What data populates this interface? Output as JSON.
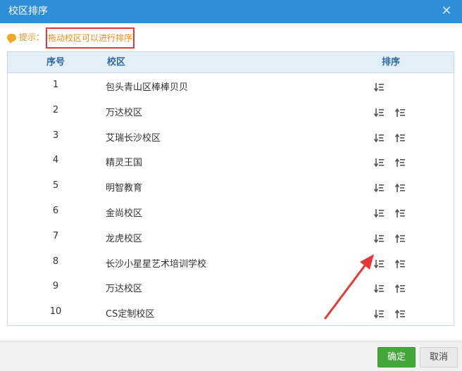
{
  "dialog": {
    "title": "校区排序",
    "close_icon": "close-icon"
  },
  "tip": {
    "label": "提示：",
    "message": "拖动校区可以进行排序"
  },
  "table": {
    "headers": {
      "index": "序号",
      "campus": "校区",
      "sort": "排序"
    },
    "rows": [
      {
        "index": "1",
        "name": "包头青山区棒棒贝贝",
        "up": false
      },
      {
        "index": "2",
        "name": "万达校区",
        "up": true
      },
      {
        "index": "3",
        "name": "艾瑞长沙校区",
        "up": true
      },
      {
        "index": "4",
        "name": "精灵王国",
        "up": true
      },
      {
        "index": "5",
        "name": "明智教育",
        "up": true
      },
      {
        "index": "6",
        "name": "金尚校区",
        "up": true
      },
      {
        "index": "7",
        "name": "龙虎校区",
        "up": true
      },
      {
        "index": "8",
        "name": "长沙小星星艺术培训学校",
        "up": true
      },
      {
        "index": "9",
        "name": "万达校区",
        "up": true
      },
      {
        "index": "10",
        "name": "CS定制校区",
        "up": true
      }
    ]
  },
  "footer": {
    "ok_label": "确定",
    "cancel_label": "取消"
  },
  "colors": {
    "titlebar": "#2d8fd8",
    "tip": "#f08b16",
    "highlight": "#e53935",
    "ok": "#43a83a"
  }
}
